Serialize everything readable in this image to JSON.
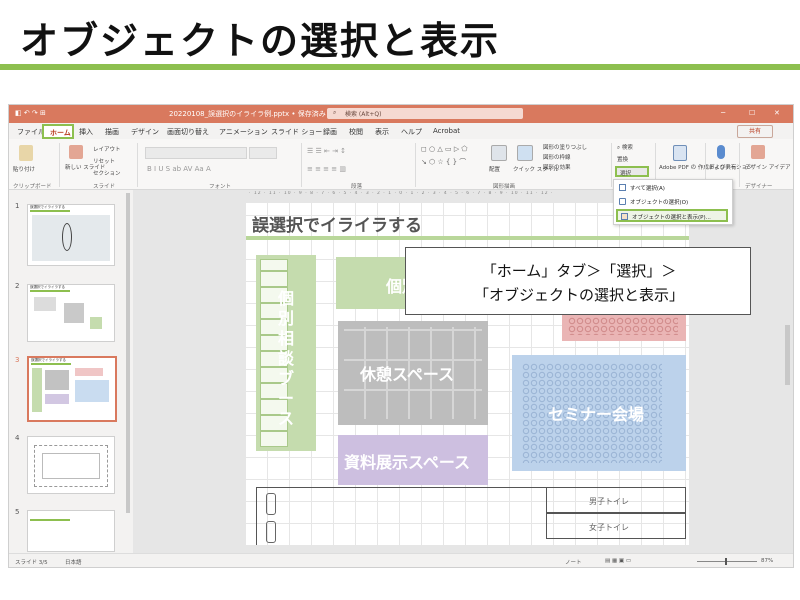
{
  "header": {
    "title": "オブジェクトの選択と表示"
  },
  "window": {
    "filename": "20220108_誤選択のイライラ例.pptx • 保存済み",
    "search_placeholder": "検索 (Alt+Q)",
    "share_label": "共有"
  },
  "menu": {
    "tabs": [
      {
        "label": "ファイル"
      },
      {
        "label": "ホーム",
        "active": true
      },
      {
        "label": "挿入"
      },
      {
        "label": "描画"
      },
      {
        "label": "デザイン"
      },
      {
        "label": "画面切り替え"
      },
      {
        "label": "アニメーション"
      },
      {
        "label": "スライド ショー"
      },
      {
        "label": "録画"
      },
      {
        "label": "校閲"
      },
      {
        "label": "表示"
      },
      {
        "label": "ヘルプ"
      },
      {
        "label": "Acrobat"
      }
    ]
  },
  "ribbon": {
    "clipboard_label": "クリップボード",
    "paste_label": "貼り付け",
    "slides_label": "スライド",
    "new_slide_label": "新しい スライド",
    "layout_label": "レイアウト",
    "reset_label": "リセット",
    "section_label": "セクション",
    "font_label": "フォント",
    "paragraph_label": "段落",
    "drawing_label": "図形描画",
    "arrange_label": "配置",
    "quick_style_label": "クイック スタイル",
    "shape_fill_label": "図形の塗りつぶし",
    "shape_outline_label": "図形の枠線",
    "shape_effect_label": "図形の効果",
    "find_label": "検索",
    "replace_label": "置換",
    "select_label": "選択",
    "adobe_label": "Adobe PDF の 作成および共有",
    "dictation_label": "ディクテーション",
    "designer_label": "デザイン アイデア",
    "designer_group_label": "デザイナー"
  },
  "select_dropdown": {
    "items": [
      {
        "label": "すべて選択(A)"
      },
      {
        "label": "オブジェクトの選択(O)"
      },
      {
        "label": "オブジェクトの選択と表示(P)...",
        "highlighted": true
      }
    ]
  },
  "thumbnails": [
    {
      "num": "1",
      "title": "誤選択でイライラする"
    },
    {
      "num": "2",
      "title": "誤選択でイライラする"
    },
    {
      "num": "3",
      "title": "誤選択でイライラする"
    },
    {
      "num": "4",
      "title": ""
    },
    {
      "num": "5",
      "title": ""
    }
  ],
  "ruler_text": "· 12 · 11 · 10 · 9 · 8 · 7 · 6 · 5 · 4 · 3 · 2 · 1 · 0 · 1 · 2 · 3 · 4 · 5 · 6 · 7 · 8 · 9 · 10 · 11 · 12 ·",
  "slide": {
    "title": "誤選択でイライラする",
    "zones": {
      "consult": "個別相談ブース",
      "consult_partial": "個別",
      "rest": "休憩スペース",
      "exhibit": "資料展示スペース",
      "seminar": "セミナー会場",
      "mens_toilet": "男子トイレ",
      "womens_toilet": "女子トイレ"
    }
  },
  "callout": {
    "line1": "「ホーム」タブ＞「選択」＞",
    "line2": "「オブジェクトの選択と表示」"
  },
  "statusbar": {
    "slide_count": "スライド 3/5",
    "language": "日本語",
    "notes": "ノート",
    "zoom": "87%"
  },
  "colors": {
    "accent": "#8dbf4f",
    "titlebar": "#d9795e",
    "consult_zone": "#b9d79a",
    "rest_zone": "#b7b7b7",
    "exhibit_zone": "#c8b9dc",
    "seminar_zone": "#b9cfe8",
    "pink_zone": "#e9a9a9"
  }
}
